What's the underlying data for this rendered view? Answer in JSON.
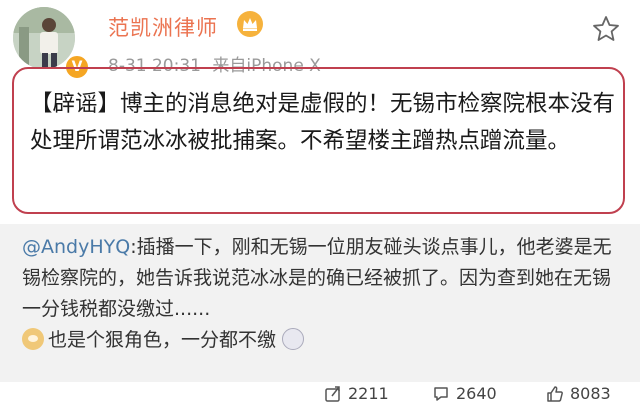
{
  "user": {
    "name": "范凯洲律师",
    "badge_letter": "V",
    "post_time": "8-31 20:31",
    "source": "来自iPhone X"
  },
  "post": {
    "text": "【辟谣】博主的消息绝对是虚假的！无锡市检察院根本没有处理所谓范冰冰被批捕案。不希望楼主蹭热点蹭流量。"
  },
  "repost": {
    "mention": "@AndyHYQ",
    "text": ":插播一下，刚和无锡一位朋友碰头谈点事儿，他老婆是无锡检察院的，她告诉我说范冰冰是的确已经被抓了。因为查到她在无锡一分钱税都没缴过......",
    "text2": "也是个狠角色，一分都不缴",
    "emoji1": "doge-emoji",
    "emoji2": "face-emoji"
  },
  "actions": {
    "repost_count": "2211",
    "comment_count": "2640",
    "like_count": "8083"
  },
  "colors": {
    "name": "#eb7350",
    "highlight_border": "#c0404f",
    "mention": "#4a7aa8",
    "repost_bg": "#f2f2f2"
  }
}
